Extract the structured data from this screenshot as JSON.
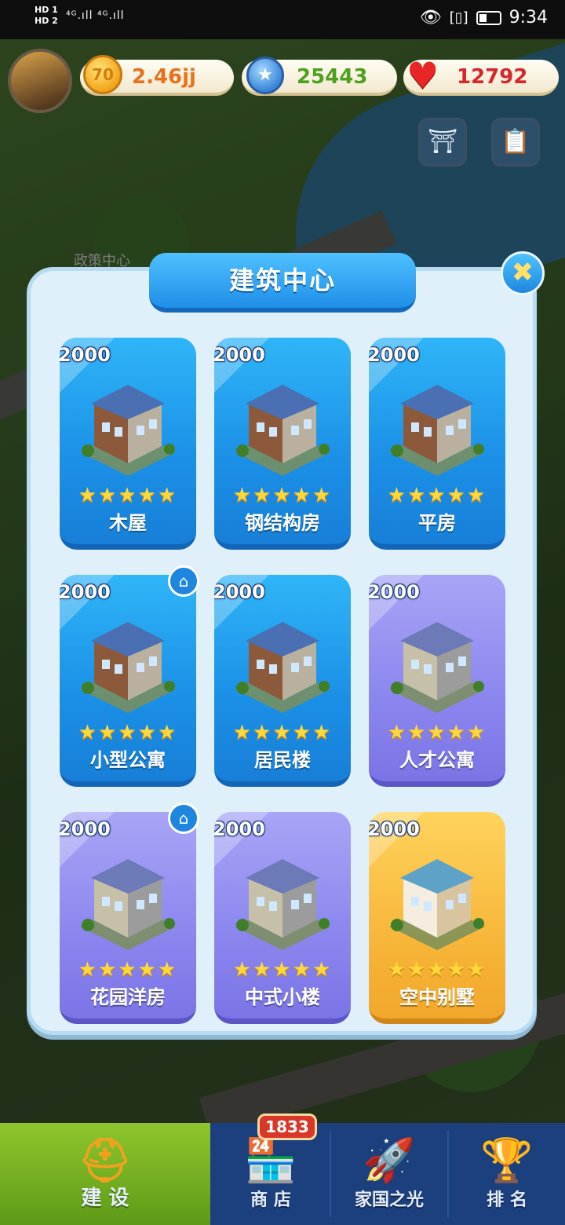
{
  "status_bar": {
    "left_top": "HD 1",
    "left_bottom": "HD 2",
    "network": "⁴ᴳ.ıll ⁴ᴳ.ıll ",
    "time": "9:34"
  },
  "hud": {
    "gold": "2.46jj",
    "gold_coin_glyph": "70",
    "gems": "25443",
    "hearts": "12792",
    "policy_center_label": "政策中心"
  },
  "modal": {
    "title": "建筑中心",
    "close_glyph": "✖",
    "cards": [
      {
        "price": "2000",
        "stars": "★★★★★",
        "name": "木屋",
        "tier": "blue",
        "new": false
      },
      {
        "price": "2000",
        "stars": "★★★★★",
        "name": "钢结构房",
        "tier": "blue",
        "new": false
      },
      {
        "price": "2000",
        "stars": "★★★★★",
        "name": "平房",
        "tier": "blue",
        "new": false
      },
      {
        "price": "2000",
        "stars": "★★★★★",
        "name": "小型公寓",
        "tier": "blue",
        "new": true
      },
      {
        "price": "2000",
        "stars": "★★★★★",
        "name": "居民楼",
        "tier": "blue",
        "new": false
      },
      {
        "price": "2000",
        "stars": "★★★★★",
        "name": "人才公寓",
        "tier": "purple",
        "new": false
      },
      {
        "price": "2000",
        "stars": "★★★★★",
        "name": "花园洋房",
        "tier": "purple",
        "new": true
      },
      {
        "price": "2000",
        "stars": "★★★★★",
        "name": "中式小楼",
        "tier": "purple",
        "new": false
      },
      {
        "price": "2000",
        "stars": "★★★★★",
        "name": "空中别墅",
        "tier": "gold",
        "new": false
      }
    ]
  },
  "bottom_nav": {
    "tabs": [
      {
        "label": "建 设",
        "icon": "hard-hat-icon",
        "active": true
      },
      {
        "label": "商 店",
        "icon": "shop-icon",
        "active": false
      },
      {
        "label": "家国之光",
        "icon": "rocket-icon",
        "active": false
      },
      {
        "label": "排 名",
        "icon": "ranking-icon",
        "active": false
      }
    ],
    "shop_badge": "1833"
  },
  "colors": {
    "card_blue": "#1b8fe6",
    "card_purple": "#8b86ee",
    "card_gold": "#f7b73a",
    "modal_bg": "#dff0fb",
    "nav_bg": "#1c3f7d"
  }
}
